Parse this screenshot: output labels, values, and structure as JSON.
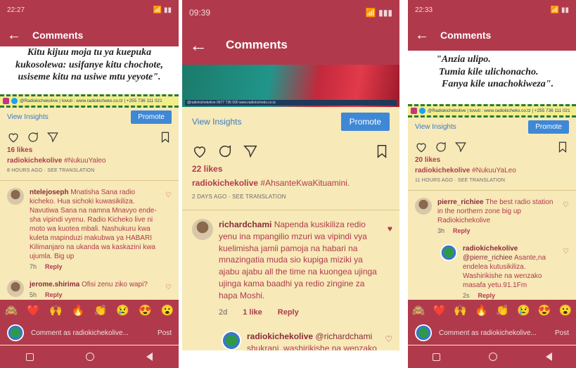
{
  "p1": {
    "status_time": "22:27",
    "status_right": "📶 ▮▮",
    "title": "Comments",
    "quote": [
      "Kitu kijuu moja tu ya kuepuka",
      "kukosolewa: usifanye kitu chochote,",
      "usiseme kitu na usiwe mtu yeyote\"."
    ],
    "strip": "@Radiokichekolive | tovuti : www.radiokicheko.co.tz | +255 736 111 021",
    "view_insights": "View Insights",
    "promote": "Promote",
    "likes": "16 likes",
    "caption_user": "radiokichekolive",
    "caption_tag": "#NukuuYaleo",
    "meta": "8 HOURS AGO · SEE TRANSLATION",
    "comments": [
      {
        "user": "ntelejoseph",
        "text": "Mnatisha Sana radio kicheko. Hua sichoki kuwasikiliza. Navutiwa Sana na namna Mnavyo ende-sha vipindi vyenu. Radio Kicheko live ni moto wa kuotea mbali. Nashukuru kwa kuleta mapinduzi makubwa ya HABARI Kilimanjaro na ukanda wa kaskazini kwa ujumla. Big up",
        "age": "7h",
        "reply": "Reply"
      },
      {
        "user": "jerome.shirima",
        "text": "Ofisi zenu ziko wapi?",
        "age": "5h",
        "reply": "Reply"
      }
    ],
    "emojis": [
      "🙈",
      "❤️",
      "🙌",
      "🔥",
      "👏",
      "😢",
      "😍",
      "😮"
    ],
    "comment_as": "Comment as radiokichekolive...",
    "post": "Post"
  },
  "p2": {
    "status_time": "09:39",
    "status_right": "📶 ▮▮▮",
    "title": "Comments",
    "logos": "@radiokichekolive  0677 736 000  www.radiokicheko.co.tz",
    "view_insights": "View Insights",
    "promote": "Promote",
    "likes": "22 likes",
    "caption_user": "radiokichekolive",
    "caption_tag": "#AhsanteKwaKituamini.",
    "meta": "2 DAYS AGO · SEE TRANSLATION",
    "comments": [
      {
        "user": "richardchami",
        "text": "Napenda kusikiliza redio yenu ina mpangilio mzuri wa vipindi vya kuelimisha jamii pamoja na habari na mnazingatia muda sio kupiga miziki ya ajabu ajabu all the time na kuongea ujinga ujinga kama baadhi ya redio zingine za hapa Moshi.",
        "age": "2d",
        "likes": "1 like",
        "reply": "Reply"
      }
    ],
    "reply_comment": {
      "user": "radiokichekolive",
      "mention": "@richardchami",
      "text": "shukrani..washirikishe na wenzako habari njema za @radiokichekolive"
    }
  },
  "p3": {
    "status_time": "22:33",
    "status_right": "📶 ▮▮",
    "title": "Comments",
    "quote": [
      "\"Anzia ulipo.",
      "Tumia kile ulichonacho.",
      "Fanya kile unachokiweza\"."
    ],
    "strip": "@Radiokichekolive | tovuti : www.radiokicheko.co.tz | +255 736 111 021",
    "view_insights": "View Insights",
    "promote": "Promote",
    "likes": "20 likes",
    "caption_user": "radiokichekolive",
    "caption_tag": "#NukuuYaLeo",
    "meta": "11 HOURS AGO · SEE TRANSLATION",
    "comments": [
      {
        "user": "pierre_richiee",
        "text": "The best radio station in the northern zone big up Radiokichekolive",
        "age": "3h",
        "reply": "Reply"
      }
    ],
    "reply_comment": {
      "user": "radiokichekolive",
      "mention": "@pierre_richiee",
      "text": "Asante,na endelea kutusikiliza. Washirikishe na wenzako masafa yetu.91.1Fm",
      "age": "2s",
      "reply": "Reply"
    },
    "emojis": [
      "🙈",
      "❤️",
      "🙌",
      "🔥",
      "👏",
      "😢",
      "😍",
      "😮"
    ],
    "comment_as": "Comment as radiokichekolive...",
    "post": "Post"
  }
}
